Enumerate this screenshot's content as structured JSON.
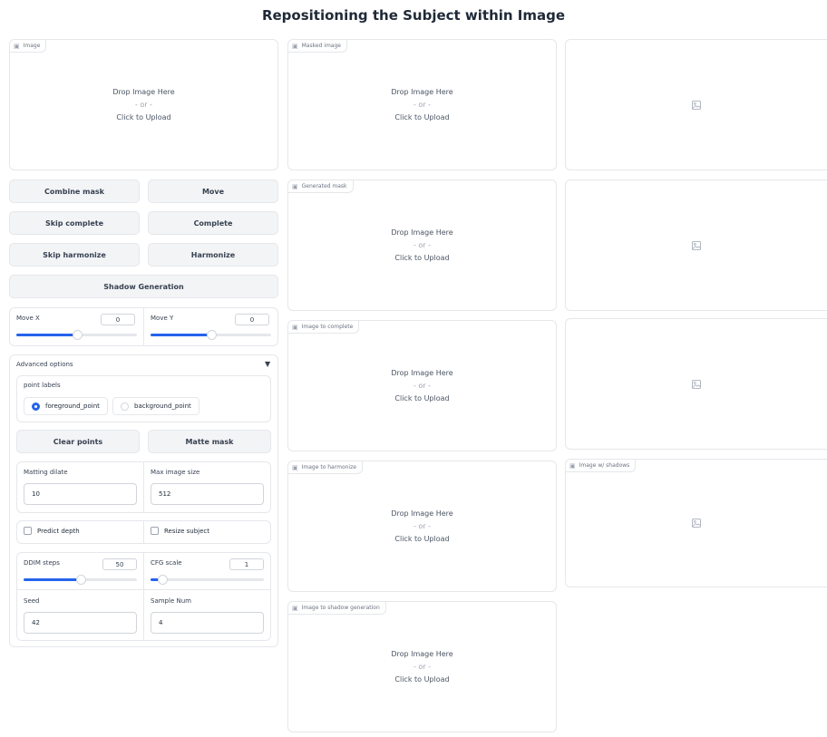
{
  "page": {
    "title": "Repositioning the Subject within Image"
  },
  "drop": {
    "line1": "Drop Image Here",
    "line2": "- or -",
    "line3": "Click to Upload"
  },
  "images": {
    "image": "Image",
    "masked_image": "Masked image",
    "generated_mask": "Generated mask",
    "image_to_complete": "Image to complete",
    "image_to_harmonize": "Image to harmonize",
    "image_to_shadow_generation": "Image to shadow generation",
    "image_with_shadows": "Image w/ shadows"
  },
  "buttons": {
    "combine_mask": "Combine mask",
    "move": "Move",
    "skip_complete": "Skip complete",
    "complete": "Complete",
    "skip_harmonize": "Skip harmonize",
    "harmonize": "Harmonize",
    "shadow_generation": "Shadow Generation",
    "clear_points": "Clear points",
    "matte_mask": "Matte mask"
  },
  "sliders": {
    "move_x": {
      "label": "Move X",
      "value": "0",
      "fraction": 0.5
    },
    "move_y": {
      "label": "Move Y",
      "value": "0",
      "fraction": 0.5
    },
    "ddim_steps": {
      "label": "DDIM steps",
      "value": "50",
      "fraction": 0.5
    },
    "cfg_scale": {
      "label": "CFG scale",
      "value": "1",
      "fraction": 0.1
    }
  },
  "advanced": {
    "title": "Advanced options",
    "toggle": "▼",
    "point_labels": {
      "label": "point labels",
      "options": [
        "foreground_point",
        "background_point"
      ],
      "selected": "foreground_point"
    },
    "matting_dilate": {
      "label": "Matting dilate",
      "value": "10"
    },
    "max_image_size": {
      "label": "Max image size",
      "value": "512"
    },
    "predict_depth": "Predict depth",
    "resize_subject": "Resize subject",
    "seed": {
      "label": "Seed",
      "value": "42"
    },
    "sample_num": {
      "label": "Sample Num",
      "value": "4"
    }
  },
  "colors": {
    "accent": "#2563eb",
    "border": "#e5e7eb",
    "button_bg": "#f3f4f6"
  },
  "icons": {
    "image_label": "image-icon",
    "placeholder": "image-placeholder-icon"
  }
}
